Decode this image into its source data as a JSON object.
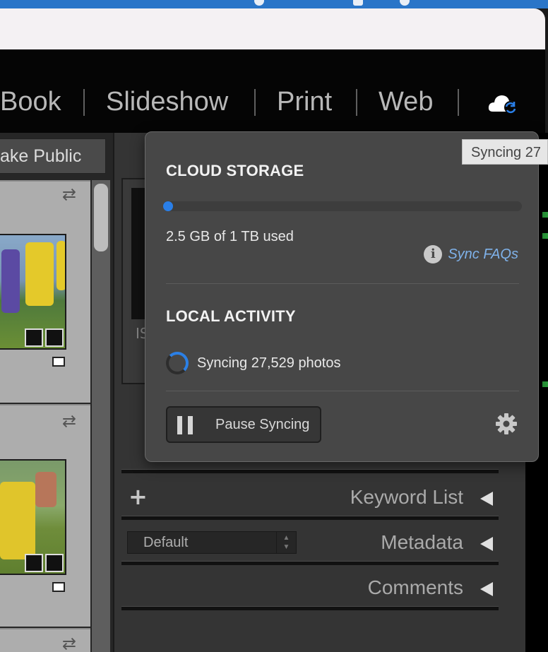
{
  "nav": {
    "items": [
      "Book",
      "Slideshow",
      "Print",
      "Web"
    ]
  },
  "left_panel": {
    "make_public_label": "ake Public"
  },
  "frame_partial_text": "IS",
  "tooltip": {
    "text": "Syncing 27"
  },
  "cloud_popover": {
    "storage_heading": "CLOUD STORAGE",
    "storage_used_fraction": 0.0025,
    "used_text": "2.5 GB of 1 TB used",
    "faq_link": "Sync FAQs",
    "activity_heading": "LOCAL ACTIVITY",
    "sync_status": "Syncing 27,529 photos",
    "pause_button": "Pause Syncing"
  },
  "panels": {
    "keyword_list": "Keyword List",
    "metadata": "Metadata",
    "comments": "Comments",
    "metadata_preset": "Default"
  },
  "colors": {
    "accent_blue": "#2a7fe8",
    "link_blue": "#7fb2ea"
  }
}
